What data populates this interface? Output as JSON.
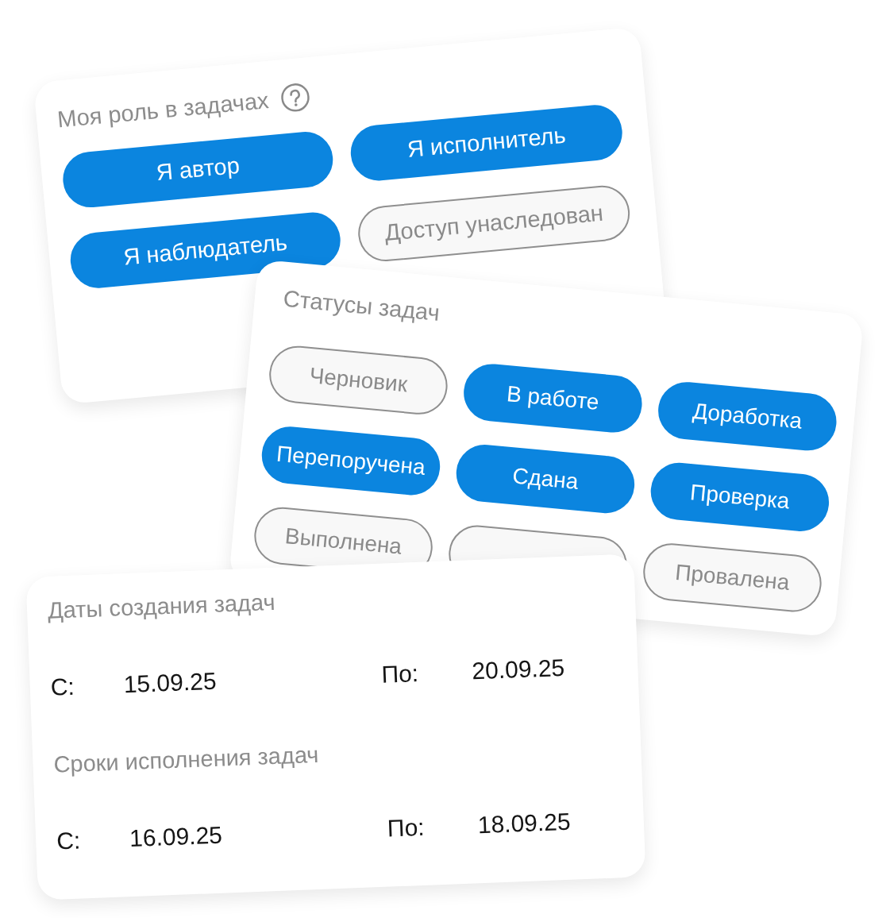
{
  "role_card": {
    "title": "Моя роль в задачах",
    "roles": [
      {
        "label": "Я автор",
        "selected": true
      },
      {
        "label": "Я исполнитель",
        "selected": true
      },
      {
        "label": "Я наблюдатель",
        "selected": true
      },
      {
        "label": "Доступ унаследован",
        "selected": false
      }
    ]
  },
  "status_card": {
    "title": "Статусы задач",
    "statuses": [
      {
        "label": "Черновик",
        "selected": false
      },
      {
        "label": "В работе",
        "selected": true
      },
      {
        "label": "Доработка",
        "selected": true
      },
      {
        "label": "Перепоручена",
        "selected": true
      },
      {
        "label": "Сдана",
        "selected": true
      },
      {
        "label": "Проверка",
        "selected": true
      },
      {
        "label": "Выполнена",
        "selected": false
      },
      {
        "selected": false
      },
      {
        "label": "Провалена",
        "selected": false
      }
    ]
  },
  "dates_card": {
    "sections": [
      {
        "title": "Даты создания задач",
        "from_label": "С:",
        "from": "15.09.25",
        "to_label": "По:",
        "to": "20.09.25"
      },
      {
        "title": "Сроки исполнения задач",
        "from_label": "С:",
        "from": "16.09.25",
        "to_label": "По:",
        "to": "18.09.25"
      }
    ]
  }
}
